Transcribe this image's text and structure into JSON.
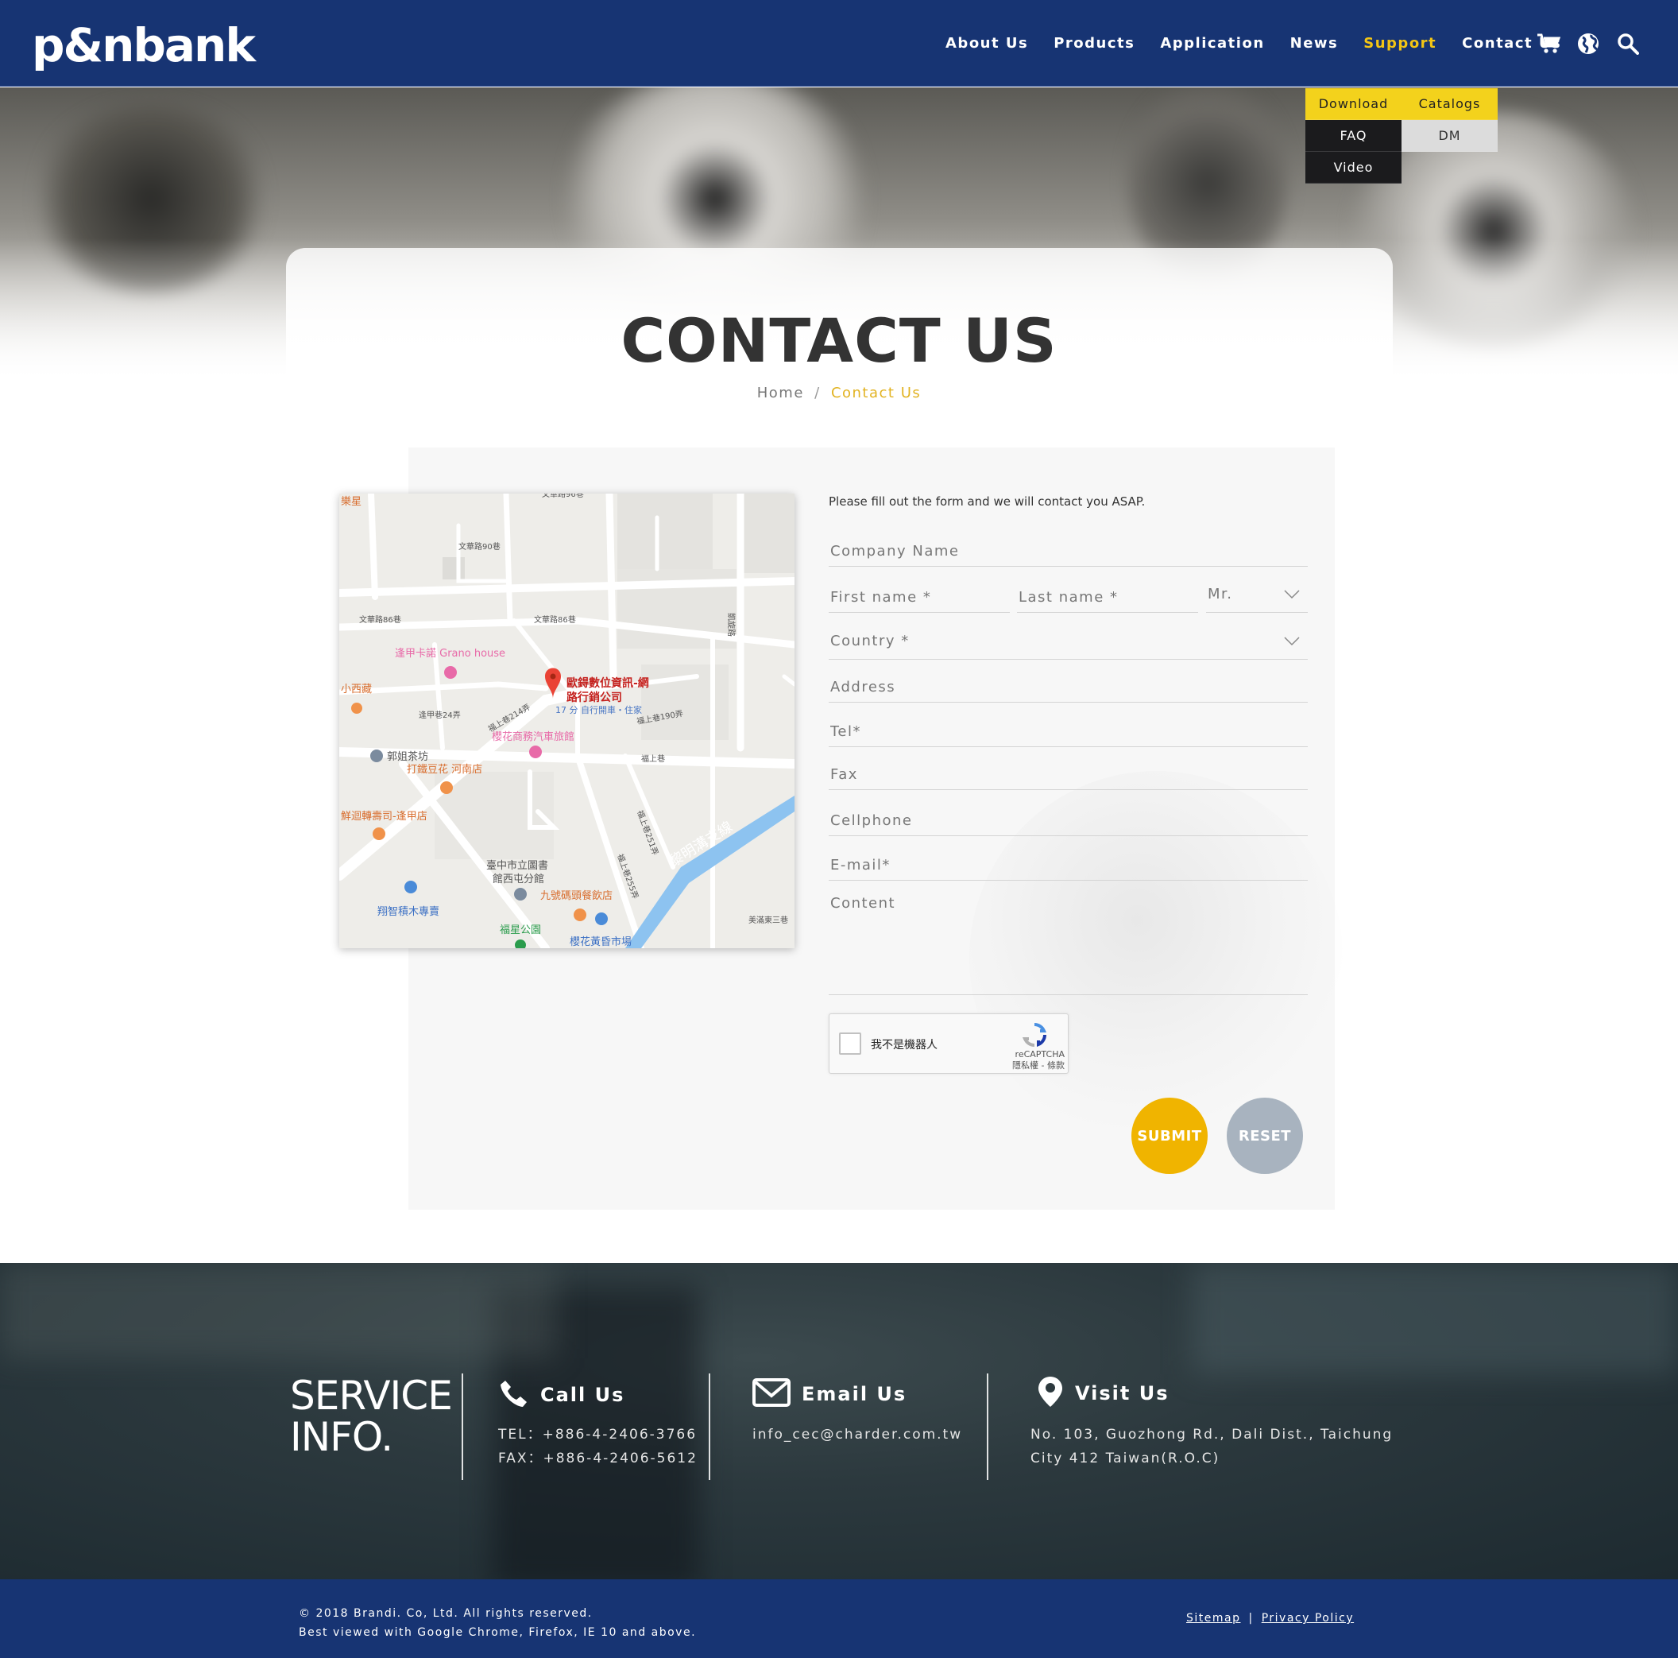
{
  "header": {
    "logo_text": "p&nbank",
    "nav": [
      {
        "label": "About Us",
        "active": false
      },
      {
        "label": "Products",
        "active": false
      },
      {
        "label": "Application",
        "active": false
      },
      {
        "label": "News",
        "active": false
      },
      {
        "label": "Support",
        "active": true
      },
      {
        "label": "Contact Us",
        "active": false
      }
    ],
    "icons": [
      "cart-icon",
      "globe-icon",
      "search-icon"
    ],
    "colors": {
      "bar": "#173473",
      "active": "#f3c514"
    }
  },
  "support_menu": {
    "items": [
      "Download",
      "Catalogs",
      "FAQ",
      "DM",
      "Video"
    ]
  },
  "page": {
    "title": "CONTACT US",
    "breadcrumb": {
      "home": "Home",
      "separator": "/",
      "current": "Contact Us"
    }
  },
  "map": {
    "pin_label_line1": "歐鍀數位資訊-網",
    "pin_label_line2": "路行銷公司",
    "pin_sub": "17 分 自行開車・住家",
    "pois": [
      "逢甲卡諾 Grano house",
      "小西藏",
      "郭姐茶坊",
      "打鐵豆花 河南店",
      "鮮迴轉壽司-逢甲店",
      "櫻花商務汽車旅館",
      "臺中市立圖書",
      "館西屯分館",
      "九號碼頭餐飲店",
      "翔智積木專賣",
      "福星公園",
      "櫻花黃昏市場",
      "黎明溝支線",
      "樂星"
    ],
    "streets": [
      "文華路90巷",
      "文華路86巷",
      "文華路86巷",
      "逢甲巷24弄",
      "福上巷214弄",
      "福上巷190弄",
      "福上巷",
      "福上巷251弄",
      "福上巷255弄",
      "凱旋路",
      "美滿東三巷",
      "文華路96巷"
    ]
  },
  "form": {
    "intro": "Please fill out the form and we will contact you ASAP.",
    "company_placeholder": "Company Name",
    "first_name_placeholder": "First name *",
    "last_name_placeholder": "Last name *",
    "title_value": "Mr.",
    "country_value": "Country *",
    "address_placeholder": "Address",
    "tel_placeholder": "Tel*",
    "fax_placeholder": "Fax",
    "cellphone_placeholder": "Cellphone",
    "email_placeholder": "E-mail*",
    "content_placeholder": "Content",
    "recaptcha_label": "我不是機器人",
    "recaptcha_brand": "reCAPTCHA",
    "recaptcha_terms": "隱私權 - 條款",
    "submit_label": "SUBMIT",
    "reset_label": "RESET",
    "colors": {
      "submit": "#f0b400",
      "reset": "#a8b3bf"
    }
  },
  "service": {
    "title_line1": "SERVICE",
    "title_line2": "INFO.",
    "call": {
      "heading": "Call Us",
      "tel": "TEL：+886-4-2406-3766",
      "fax": "FAX：+886-4-2406-5612"
    },
    "email": {
      "heading": "Email Us",
      "address": "info_cec@charder.com.tw"
    },
    "visit": {
      "heading": "Visit Us",
      "line1": "No. 103, Guozhong Rd., Dali Dist., Taichung",
      "line2": "City 412 Taiwan(R.O.C)"
    }
  },
  "footer": {
    "copyright": "© 2018 Brandi. Co, Ltd. All rights reserved.",
    "browsers": "Best viewed with Google Chrome, Firefox, IE 10 and above.",
    "sitemap": "Sitemap",
    "divider": "|",
    "privacy": "Privacy Policy"
  }
}
